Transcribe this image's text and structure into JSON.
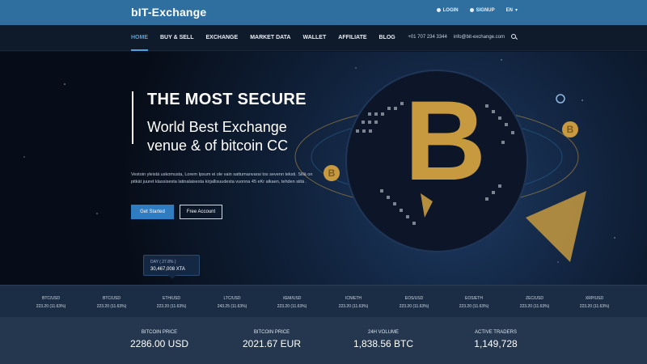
{
  "brand": {
    "logo": "bIT-Exchange"
  },
  "top_actions": {
    "login": "LOGIN",
    "register": "SIGNUP",
    "lang": "EN"
  },
  "nav": {
    "items": [
      "HOME",
      "BUY & SELL",
      "EXCHANGE",
      "MARKET DATA",
      "WALLET",
      "AFFILIATE",
      "BLOG"
    ],
    "active": "HOME"
  },
  "contact": {
    "phone": "+01 707 234 3344",
    "email": "info@bit-exchange.com"
  },
  "hero": {
    "title": "THE MOST SECURE",
    "subtitle": "World Best Exchange venue & of bitcoin CC",
    "paragraph": "Vestoin yleistä uskomusta, Lorem Ipsum ei ole vain sattumanvarai tos sevenn teksti. Sillä on pitkät juuret klassisesta latinalaisesta kirjallisuudesta vuonna 45 eKr alkaen, tehden siitä .",
    "primary_button": "Get Started",
    "secondary_button": "Free Account",
    "tooltip_label": "DAY ( 27.8% )",
    "tooltip_value": "30,467,008 XTA",
    "coin_symbol": "B"
  },
  "ticker": [
    {
      "pair": "BTC/USD",
      "value": "223.20 (11.63%)"
    },
    {
      "pair": "BTC/USD",
      "value": "223.20 (11.63%)"
    },
    {
      "pair": "ETH/USD",
      "value": "223.20 (11.63%)"
    },
    {
      "pair": "LTC/USD",
      "value": "243.25 (11.63%)"
    },
    {
      "pair": "XEM/USD",
      "value": "223.20 (11.63%)"
    },
    {
      "pair": "ICN/ETH",
      "value": "223.20 (11.63%)"
    },
    {
      "pair": "EOS/USD",
      "value": "223.20 (11.63%)"
    },
    {
      "pair": "EOS/ETH",
      "value": "223.20 (11.63%)"
    },
    {
      "pair": "ZEC/USD",
      "value": "223.20 (11.63%)"
    },
    {
      "pair": "XRP/USD",
      "value": "223.20 (11.63%)"
    }
  ],
  "stats": [
    {
      "label": "BITCOIN PRICE",
      "value": "2286.00 USD"
    },
    {
      "label": "BITCOIN PRICE",
      "value": "2021.67 EUR"
    },
    {
      "label": "24H VOLUME",
      "value": "1,838.56 BTC"
    },
    {
      "label": "ACTIVE TRADERS",
      "value": "1,149,728"
    }
  ],
  "colors": {
    "topbar": "#2e6fa0",
    "navbar": "#0f1a2b",
    "accent": "#4aa3e0",
    "gold": "#c79a3f",
    "ticker_bg": "#1b2d44",
    "stats_bg": "#24374e"
  }
}
